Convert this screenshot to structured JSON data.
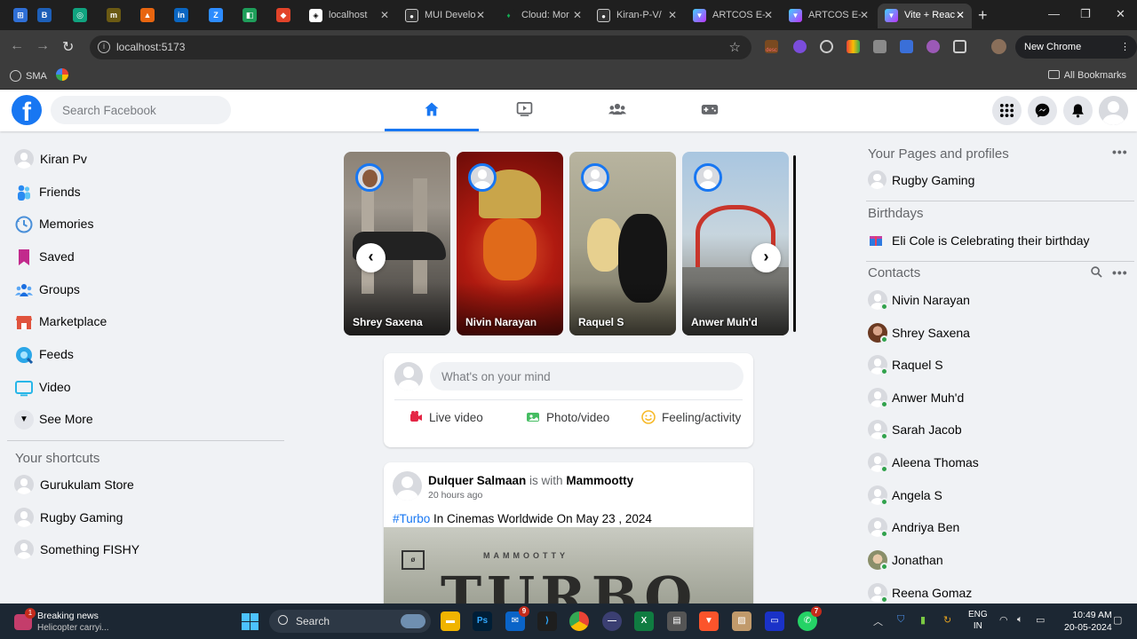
{
  "browser": {
    "tabs": [
      {
        "label": "localhost",
        "icon": "localhost-icon"
      },
      {
        "label": "MUI Develo",
        "icon": "github-icon"
      },
      {
        "label": "Cloud: Mor",
        "icon": "mongodb-icon"
      },
      {
        "label": "Kiran-P-V/",
        "icon": "github-icon"
      },
      {
        "label": "ARTCOS E-",
        "icon": "vite-icon"
      },
      {
        "label": "ARTCOS E-",
        "icon": "vite-icon"
      },
      {
        "label": "Vite + Reac",
        "icon": "vite-icon"
      }
    ],
    "url": "localhost:5173",
    "new_chrome_label": "New Chrome available",
    "bookmarks": [
      {
        "label": "SMA"
      }
    ],
    "all_bookmarks_label": "All Bookmarks",
    "ext_desc_label": "desc"
  },
  "facebook": {
    "search_placeholder": "Search Facebook",
    "nav_tabs": [
      "home",
      "watch",
      "groups",
      "gaming"
    ],
    "accent_color": "#1877f2",
    "left_menu": [
      {
        "label": "Kiran Pv",
        "icon": "avatar"
      },
      {
        "label": "Friends",
        "icon": "friends-icon"
      },
      {
        "label": "Memories",
        "icon": "memories-icon"
      },
      {
        "label": "Saved",
        "icon": "saved-icon"
      },
      {
        "label": "Groups",
        "icon": "groups-icon"
      },
      {
        "label": "Marketplace",
        "icon": "marketplace-icon"
      },
      {
        "label": "Feeds",
        "icon": "feeds-icon"
      },
      {
        "label": "Video",
        "icon": "video-icon"
      },
      {
        "label": "See More",
        "icon": "chevron-down-icon"
      }
    ],
    "shortcuts_title": "Your shortcuts",
    "shortcuts": [
      {
        "label": "Gurukulam Store"
      },
      {
        "label": "Rugby Gaming"
      },
      {
        "label": "Something FISHY"
      }
    ],
    "stories": [
      {
        "name": "Shrey Saxena"
      },
      {
        "name": "Nivin Narayan"
      },
      {
        "name": "Raquel S"
      },
      {
        "name": "Anwer Muh'd"
      }
    ],
    "composer": {
      "placeholder": "What's on your mind",
      "live_label": "Live video",
      "photo_label": "Photo/video",
      "feeling_label": "Feeling/activity"
    },
    "post": {
      "author": "Dulquer Salmaan",
      "with_word": "is with",
      "with_name": "Mammootty",
      "time": "20 hours ago",
      "hashtag": "#Turbo",
      "text": "In Cinemas Worldwide On May 23 , 2024",
      "image_small": "MAMMOOTTY",
      "image_big": "TURBO"
    },
    "right": {
      "pages_title": "Your Pages and profiles",
      "pages": [
        {
          "label": "Rugby Gaming"
        }
      ],
      "birthdays_title": "Birthdays",
      "birthday_text": "Eli Cole is Celebrating their birthday",
      "contacts_title": "Contacts",
      "contacts": [
        {
          "label": "Nivin Narayan"
        },
        {
          "label": "Shrey Saxena"
        },
        {
          "label": "Raquel S"
        },
        {
          "label": "Anwer Muh'd"
        },
        {
          "label": "Sarah Jacob"
        },
        {
          "label": "Aleena Thomas"
        },
        {
          "label": "Angela S"
        },
        {
          "label": "Andriya Ben"
        },
        {
          "label": "Jonathan"
        },
        {
          "label": "Reena Gomaz"
        }
      ]
    }
  },
  "taskbar": {
    "news_title": "Breaking news",
    "news_sub": "Helicopter carryi...",
    "news_badge": "1",
    "search_label": "Search",
    "mail_badge": "9",
    "whatsapp_badge": "7",
    "lang_top": "ENG",
    "lang_bottom": "IN",
    "time": "10:49 AM",
    "date": "20-05-2024"
  }
}
